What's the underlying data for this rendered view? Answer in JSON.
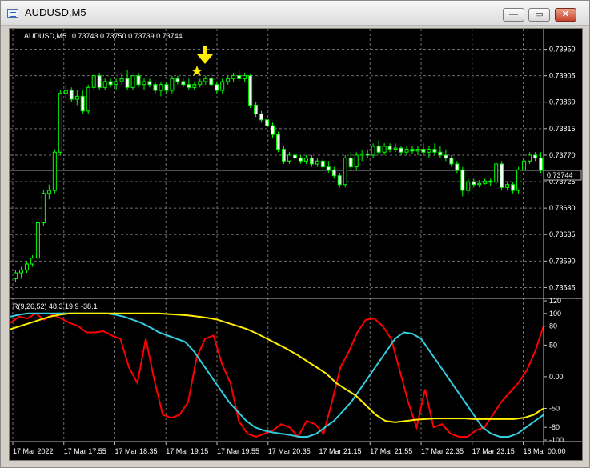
{
  "window": {
    "title": "AUDUSD,M5",
    "minimize": "—",
    "maximize": "▭",
    "close": "✕"
  },
  "chart": {
    "symbol_header": "AUDUSD,M5",
    "ohlc": "0.73743 0.73750 0.73739 0.73744",
    "current_price": "0.73744",
    "indicator_header": "R(9,26,52) 48.3 19.9 -38.1",
    "arrow_icon": "yellow-down-arrow-icon",
    "star_icon": "yellow-star-icon"
  },
  "chart_data": [
    {
      "type": "candlestick",
      "title": "AUDUSD,M5",
      "price_ticks": [
        "0.73950",
        "0.73905",
        "0.73860",
        "0.73815",
        "0.73770",
        "0.73725",
        "0.73680",
        "0.73635",
        "0.73590",
        "0.73545"
      ],
      "ylim": [
        0.73532,
        0.73982
      ],
      "time_ticks": [
        "17 Mar 2022",
        "17 Mar 17:55",
        "17 Mar 18:35",
        "17 Mar 19:15",
        "17 Mar 19:55",
        "17 Mar 20:35",
        "17 Mar 21:15",
        "17 Mar 21:55",
        "17 Mar 22:35",
        "17 Mar 23:15",
        "18 Mar 00:00"
      ],
      "candles": [
        [
          0.7356,
          0.73575,
          0.73555,
          0.7357
        ],
        [
          0.7357,
          0.7358,
          0.7356,
          0.73575
        ],
        [
          0.73575,
          0.7359,
          0.7357,
          0.73585
        ],
        [
          0.73585,
          0.736,
          0.7358,
          0.73595
        ],
        [
          0.73595,
          0.7366,
          0.7359,
          0.73655
        ],
        [
          0.73655,
          0.7371,
          0.7365,
          0.73705
        ],
        [
          0.73705,
          0.7372,
          0.73695,
          0.7371
        ],
        [
          0.7371,
          0.7378,
          0.73705,
          0.73775
        ],
        [
          0.73775,
          0.7388,
          0.7377,
          0.73875
        ],
        [
          0.73875,
          0.7389,
          0.73865,
          0.7388
        ],
        [
          0.7388,
          0.73885,
          0.7386,
          0.73865
        ],
        [
          0.73865,
          0.7388,
          0.73855,
          0.7387
        ],
        [
          0.7387,
          0.7388,
          0.7384,
          0.73845
        ],
        [
          0.73845,
          0.7389,
          0.7384,
          0.73885
        ],
        [
          0.73885,
          0.73905,
          0.7388,
          0.73905
        ],
        [
          0.73905,
          0.7391,
          0.7388,
          0.73885
        ],
        [
          0.73885,
          0.739,
          0.7388,
          0.73895
        ],
        [
          0.73895,
          0.739,
          0.73885,
          0.7389
        ],
        [
          0.7389,
          0.739,
          0.7388,
          0.73895
        ],
        [
          0.73895,
          0.7391,
          0.7389,
          0.739
        ],
        [
          0.739,
          0.73915,
          0.7388,
          0.73885
        ],
        [
          0.73885,
          0.73905,
          0.7388,
          0.73905
        ],
        [
          0.73905,
          0.7391,
          0.73885,
          0.7389
        ],
        [
          0.7389,
          0.739,
          0.7388,
          0.73895
        ],
        [
          0.73895,
          0.739,
          0.73885,
          0.7389
        ],
        [
          0.7389,
          0.73895,
          0.73875,
          0.7388
        ],
        [
          0.7388,
          0.73895,
          0.7387,
          0.7389
        ],
        [
          0.7389,
          0.73895,
          0.73875,
          0.7388
        ],
        [
          0.7388,
          0.73905,
          0.73875,
          0.739
        ],
        [
          0.739,
          0.73905,
          0.7389,
          0.73895
        ],
        [
          0.73895,
          0.739,
          0.73885,
          0.7389
        ],
        [
          0.7389,
          0.739,
          0.7388,
          0.73885
        ],
        [
          0.73885,
          0.73895,
          0.7388,
          0.7389
        ],
        [
          0.7389,
          0.739,
          0.73885,
          0.73895
        ],
        [
          0.73895,
          0.73905,
          0.7389,
          0.739
        ],
        [
          0.739,
          0.7391,
          0.73885,
          0.7389
        ],
        [
          0.7389,
          0.73895,
          0.73875,
          0.7388
        ],
        [
          0.7388,
          0.739,
          0.73875,
          0.73895
        ],
        [
          0.73895,
          0.73905,
          0.7389,
          0.739
        ],
        [
          0.739,
          0.7391,
          0.73895,
          0.73905
        ],
        [
          0.73905,
          0.73915,
          0.73895,
          0.739
        ],
        [
          0.739,
          0.7391,
          0.73895,
          0.73905
        ],
        [
          0.73905,
          0.73908,
          0.7385,
          0.73855
        ],
        [
          0.73855,
          0.7386,
          0.73835,
          0.7384
        ],
        [
          0.7384,
          0.73845,
          0.73825,
          0.7383
        ],
        [
          0.7383,
          0.73835,
          0.73815,
          0.7382
        ],
        [
          0.7382,
          0.73825,
          0.738,
          0.73805
        ],
        [
          0.73805,
          0.7381,
          0.73775,
          0.7378
        ],
        [
          0.7378,
          0.73785,
          0.73755,
          0.7376
        ],
        [
          0.7376,
          0.73775,
          0.73755,
          0.7377
        ],
        [
          0.7377,
          0.73775,
          0.7376,
          0.73765
        ],
        [
          0.73765,
          0.7377,
          0.73755,
          0.7376
        ],
        [
          0.7376,
          0.7377,
          0.73755,
          0.73765
        ],
        [
          0.73765,
          0.7377,
          0.7375,
          0.73755
        ],
        [
          0.73755,
          0.73765,
          0.7375,
          0.7376
        ],
        [
          0.7376,
          0.73765,
          0.73745,
          0.7375
        ],
        [
          0.7375,
          0.7376,
          0.7374,
          0.73745
        ],
        [
          0.73745,
          0.7375,
          0.7373,
          0.73735
        ],
        [
          0.73735,
          0.7374,
          0.73715,
          0.7372
        ],
        [
          0.7372,
          0.7377,
          0.73715,
          0.73765
        ],
        [
          0.73765,
          0.73775,
          0.73745,
          0.7375
        ],
        [
          0.7375,
          0.73775,
          0.73745,
          0.7377
        ],
        [
          0.7377,
          0.73778,
          0.7376,
          0.73772
        ],
        [
          0.73772,
          0.7378,
          0.73765,
          0.7377
        ],
        [
          0.7377,
          0.7379,
          0.73765,
          0.73785
        ],
        [
          0.73785,
          0.73795,
          0.7377,
          0.73775
        ],
        [
          0.73775,
          0.7379,
          0.7377,
          0.73785
        ],
        [
          0.73785,
          0.7379,
          0.73775,
          0.7378
        ],
        [
          0.7378,
          0.7379,
          0.73775,
          0.73782
        ],
        [
          0.73782,
          0.73785,
          0.7377,
          0.73775
        ],
        [
          0.73775,
          0.73785,
          0.7377,
          0.7378
        ],
        [
          0.7378,
          0.73785,
          0.73772,
          0.73777
        ],
        [
          0.73777,
          0.73785,
          0.7377,
          0.7378
        ],
        [
          0.7378,
          0.7379,
          0.7377,
          0.73775
        ],
        [
          0.73775,
          0.73785,
          0.73765,
          0.7378
        ],
        [
          0.7378,
          0.7379,
          0.7377,
          0.73775
        ],
        [
          0.73775,
          0.73785,
          0.73765,
          0.7377
        ],
        [
          0.7377,
          0.7378,
          0.7376,
          0.73765
        ],
        [
          0.73765,
          0.7377,
          0.7375,
          0.73755
        ],
        [
          0.73755,
          0.7376,
          0.7374,
          0.73745
        ],
        [
          0.73745,
          0.7375,
          0.737,
          0.7371
        ],
        [
          0.7371,
          0.7373,
          0.73705,
          0.73725
        ],
        [
          0.73725,
          0.7373,
          0.73715,
          0.7372
        ],
        [
          0.7372,
          0.73728,
          0.73715,
          0.73722
        ],
        [
          0.73722,
          0.7373,
          0.7372,
          0.73726
        ],
        [
          0.73726,
          0.7373,
          0.73718,
          0.73724
        ],
        [
          0.73724,
          0.7376,
          0.7372,
          0.73755
        ],
        [
          0.73755,
          0.7376,
          0.7371,
          0.73715
        ],
        [
          0.73715,
          0.73725,
          0.7371,
          0.7372
        ],
        [
          0.7372,
          0.73725,
          0.73705,
          0.7371
        ],
        [
          0.7371,
          0.7375,
          0.73705,
          0.73745
        ],
        [
          0.73745,
          0.73765,
          0.7374,
          0.7376
        ],
        [
          0.7376,
          0.73775,
          0.73755,
          0.7377
        ],
        [
          0.7377,
          0.73775,
          0.7376,
          0.73765
        ],
        [
          0.73765,
          0.73775,
          0.7374,
          0.73744
        ]
      ]
    },
    {
      "type": "line",
      "title": "R(9,26,52) 48.3 19.9 -38.1",
      "ylim": [
        -100,
        120
      ],
      "yticks": [
        "120",
        "100",
        "80",
        "50",
        "0.00",
        "-50",
        "-80",
        "-100"
      ],
      "series": [
        {
          "color": "#ff0000",
          "values": [
            85,
            95,
            92,
            100,
            90,
            98,
            92,
            85,
            80,
            70,
            70,
            72,
            65,
            60,
            15,
            -10,
            60,
            -5,
            -60,
            -65,
            -60,
            -40,
            30,
            60,
            65,
            20,
            -10,
            -70,
            -90,
            -95,
            -90,
            -85,
            -75,
            -80,
            -95,
            -70,
            -75,
            -90,
            -40,
            15,
            40,
            70,
            90,
            92,
            80,
            60,
            10,
            -40,
            -80,
            -20,
            -80,
            -75,
            -90,
            -95,
            -95,
            -85,
            -80,
            -60,
            -40,
            -25,
            -10,
            10,
            40,
            80
          ]
        },
        {
          "color": "#33ccdd",
          "values": [
            95,
            98,
            100,
            100,
            100,
            100,
            100,
            100,
            100,
            100,
            100,
            100,
            98,
            95,
            90,
            85,
            78,
            70,
            65,
            60,
            55,
            40,
            20,
            0,
            -20,
            -40,
            -55,
            -70,
            -80,
            -85,
            -88,
            -90,
            -92,
            -95,
            -95,
            -90,
            -80,
            -70,
            -55,
            -40,
            -20,
            0,
            20,
            40,
            60,
            70,
            68,
            60,
            40,
            20,
            0,
            -20,
            -40,
            -60,
            -80,
            -90,
            -95,
            -95,
            -90,
            -80,
            -70,
            -60
          ]
        },
        {
          "color": "#ffee00",
          "values": [
            75,
            80,
            85,
            90,
            95,
            98,
            100,
            100,
            100,
            100,
            100,
            100,
            100,
            100,
            100,
            100,
            99,
            98,
            97,
            95,
            93,
            90,
            85,
            80,
            75,
            68,
            60,
            52,
            44,
            35,
            25,
            15,
            5,
            -10,
            -20,
            -30,
            -45,
            -60,
            -70,
            -72,
            -70,
            -68,
            -67,
            -66,
            -66,
            -66,
            -66,
            -67,
            -67,
            -67,
            -67,
            -67,
            -65,
            -60,
            -50
          ]
        }
      ]
    }
  ]
}
